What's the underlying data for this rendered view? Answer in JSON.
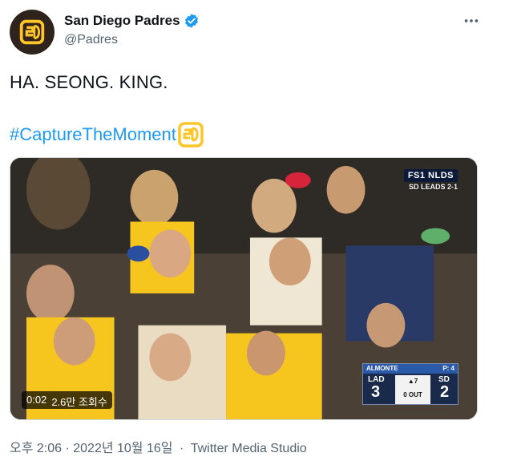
{
  "author": {
    "display_name": "San Diego Padres",
    "handle": "@Padres",
    "avatar_icon": "padres-sd-logo",
    "verified": true
  },
  "more_menu_icon": "more-horizontal-icon",
  "tweet": {
    "text": "HA. SEONG. KING.",
    "hashtag": "#CaptureTheMoment",
    "hashflag_icon": "padres-sd-hashflag"
  },
  "media": {
    "type": "video",
    "network_bug": "FS1 NLDS",
    "network_sub": "SD LEADS 2-1",
    "elapsed": "0:02",
    "views": "2.6만 조회수",
    "scorebug": {
      "batter": "ALMONTE",
      "pitch": "P: 4",
      "away_team": "LAD",
      "away_score": "3",
      "home_team": "SD",
      "home_score": "2",
      "inning": "▲7",
      "outs": "0 OUT"
    }
  },
  "meta": {
    "timestamp": "오후 2:06 · 2022년 10월 16일",
    "source": "Twitter Media Studio"
  },
  "colors": {
    "text": "#0f1419",
    "secondary": "#536471",
    "link": "#1d9bf0",
    "padres_brown": "#2f241d",
    "padres_gold": "#ffc425"
  }
}
